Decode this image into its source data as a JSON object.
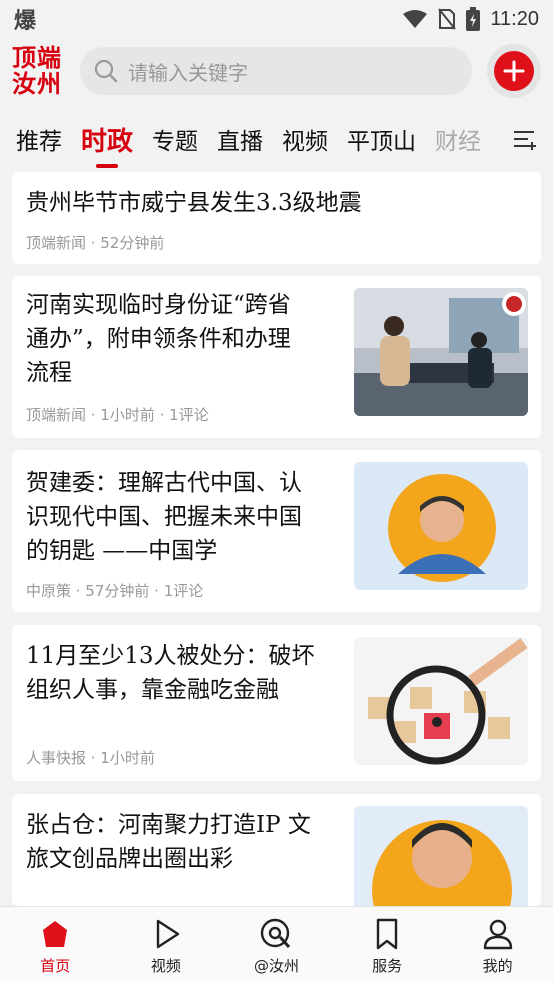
{
  "status": {
    "left_icon": "爆",
    "time": "11:20"
  },
  "header": {
    "logo_line1": "顶端",
    "logo_line2": "汝州",
    "search_placeholder": "请输入关键字"
  },
  "tabs": [
    {
      "label": "推荐"
    },
    {
      "label": "时政"
    },
    {
      "label": "专题"
    },
    {
      "label": "直播"
    },
    {
      "label": "视频"
    },
    {
      "label": "平顶山"
    },
    {
      "label": "财经"
    }
  ],
  "articles": [
    {
      "title": "贵州毕节市威宁县发生3.3级地震",
      "meta": "顶端新闻 · 52分钟前"
    },
    {
      "title_lines": [
        "河南实现临时身份证“跨省",
        "通办”，附申领条件和办理",
        "流程"
      ],
      "meta": "顶端新闻 · 1小时前 · 1评论",
      "thumb_icon": "id-office-photo"
    },
    {
      "title_lines": [
        "贺建委：理解古代中国、认",
        "识现代中国、把握未来中国",
        "的钥匙 ——中国学"
      ],
      "meta": "中原策 · 57分钟前 · 1评论",
      "thumb_icon": "portrait-photo"
    },
    {
      "title_lines": [
        "11月至少13人被处分：破坏",
        "组织人事，靠金融吃金融"
      ],
      "meta": "人事快报 · 1小时前",
      "thumb_icon": "magnifier-blocks-photo"
    },
    {
      "title_lines": [
        "张占仓：河南聚力打造IP 文",
        "旅文创品牌出圈出彩"
      ],
      "thumb_icon": "portrait-photo"
    }
  ],
  "bottom_nav": [
    {
      "label": "首页",
      "icon": "home-icon"
    },
    {
      "label": "视频",
      "icon": "play-icon"
    },
    {
      "label": "@汝州",
      "icon": "at-icon"
    },
    {
      "label": "服务",
      "icon": "bookmark-icon"
    },
    {
      "label": "我的",
      "icon": "user-icon"
    }
  ],
  "colors": {
    "accent": "#d7000f"
  }
}
